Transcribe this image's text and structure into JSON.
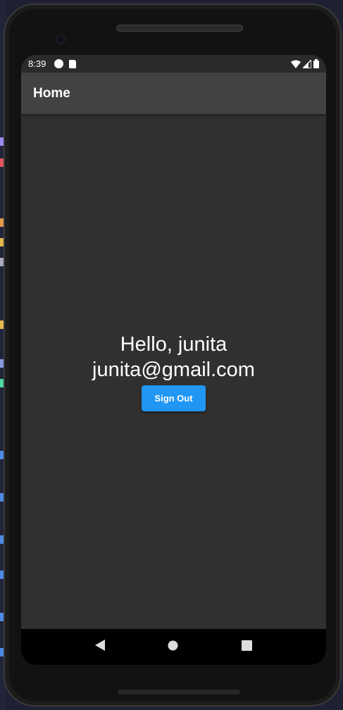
{
  "status_bar": {
    "time": "8:39",
    "icons": [
      "data-saver-icon",
      "sd-card-icon",
      "wifi-icon",
      "signal-icon",
      "battery-icon"
    ]
  },
  "app_bar": {
    "title": "Home"
  },
  "main": {
    "greeting": "Hello, junita",
    "email": "junita@gmail.com",
    "sign_out_label": "Sign Out"
  },
  "nav_bar": {
    "icons": [
      "back-icon",
      "home-icon",
      "recents-icon"
    ]
  },
  "colors": {
    "accent": "#2196f3",
    "app_bar": "#424242",
    "background": "#303030"
  }
}
